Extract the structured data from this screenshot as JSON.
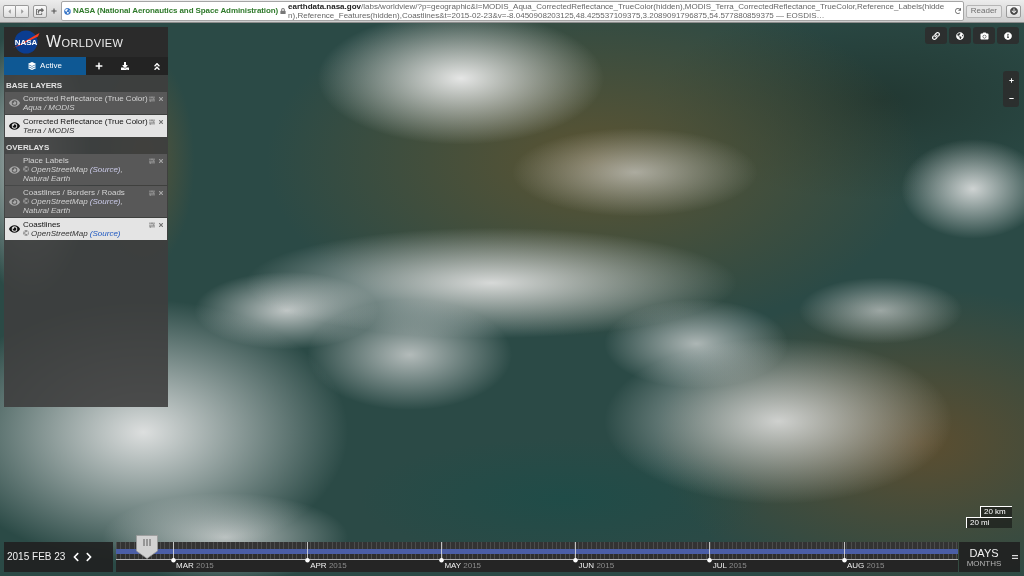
{
  "browser": {
    "site_name": "NASA (National Aeronautics and Space Administration)",
    "domain": "earthdata.nasa.gov",
    "path": "/labs/worldview/?p=geographic&l=MODIS_Aqua_CorrectedReflectance_TrueColor(hidden),MODIS_Terra_CorrectedReflectance_TrueColor,Reference_Labels(hidden),Reference_Features(hidden),Coastlines&t=2015-02-23&v=-8.0450908203125,48.425537109375,3.2089091796875,54.577880859375 — EOSDIS…",
    "reader_button": "Reader"
  },
  "app": {
    "logo_text": "NASA",
    "title": "WORLDVIEW"
  },
  "layer_panel": {
    "tabs": [
      {
        "label": "Active",
        "selected": true
      },
      {
        "selected": false
      },
      {
        "selected": false
      }
    ],
    "sections": [
      {
        "heading": "BASE LAYERS",
        "layers": [
          {
            "title": "Corrected Reflectance (True Color)",
            "subtitle": "Aqua / MODIS",
            "visible": false
          },
          {
            "title": "Corrected Reflectance (True Color)",
            "subtitle": "Terra / MODIS",
            "visible": true
          }
        ]
      },
      {
        "heading": "OVERLAYS",
        "layers": [
          {
            "title": "Place Labels",
            "subtitle": "© OpenStreetMap",
            "link": "(Source)",
            "subtitle_end": ", Natural Earth",
            "visible": false
          },
          {
            "title": "Coastlines / Borders / Roads",
            "subtitle": "© OpenStreetMap",
            "link": "(Source)",
            "subtitle_end": ", Natural Earth",
            "visible": false
          },
          {
            "title": "Coastlines",
            "subtitle": "© OpenStreetMap",
            "link": "(Source)",
            "visible": true
          }
        ]
      }
    ]
  },
  "map": {
    "scale": [
      "20 km",
      "20 mi"
    ]
  },
  "timeline": {
    "date": "2015 FEB 23",
    "level": 0.037,
    "months": [
      {
        "month": "MAR",
        "year": "2015"
      },
      {
        "month": "APR",
        "year": "2015"
      },
      {
        "month": "MAY",
        "year": "2015"
      },
      {
        "month": "JUN",
        "year": "2015"
      },
      {
        "month": "JUL",
        "year": "2015"
      },
      {
        "month": "AUG",
        "year": "2015"
      }
    ],
    "timescales": [
      {
        "label": "DAYS",
        "selected": true
      },
      {
        "label": "MONTHS",
        "selected": false
      }
    ]
  }
}
